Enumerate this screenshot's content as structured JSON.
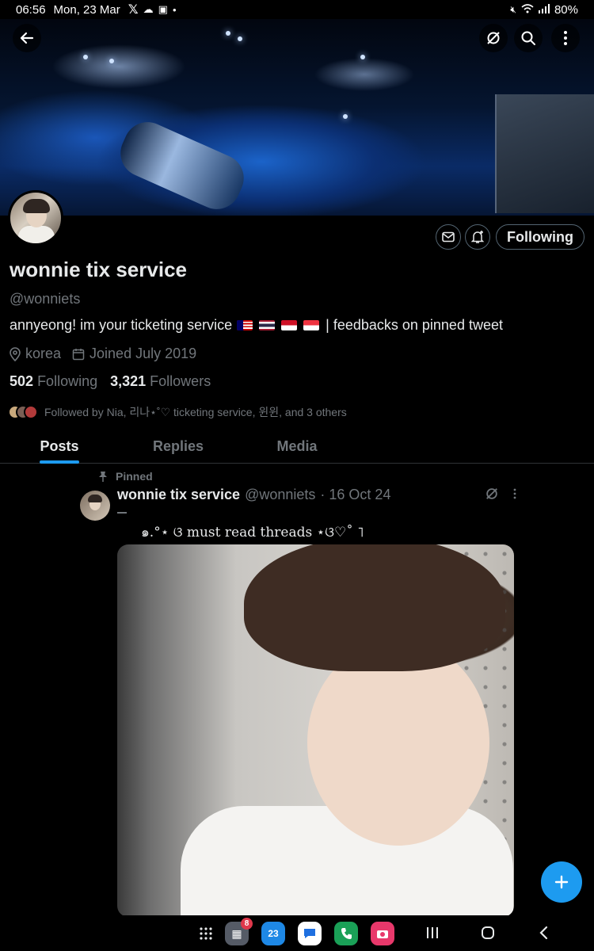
{
  "status_bar": {
    "time": "06:56",
    "date": "Mon, 23 Mar",
    "battery": "80%"
  },
  "profile": {
    "name": "wonnie tix service",
    "handle": "@wonniets",
    "bio_text": "annyeong! im your ticketing service",
    "bio_suffix": "| feedbacks on pinned tweet",
    "location": "korea",
    "joined": "Joined July 2019",
    "following_count": "502",
    "following_label": "Following",
    "followers_count": "3,321",
    "followers_label": "Followers",
    "followed_by": "Followed by Nia, 리나⋆˚♡ ticketing service, 윈윈, and 3 others",
    "follow_button": "Following"
  },
  "tabs": [
    {
      "label": "Posts",
      "active": true
    },
    {
      "label": "Replies",
      "active": false
    },
    {
      "label": "Media",
      "active": false
    }
  ],
  "post": {
    "pinned_label": "Pinned",
    "author": "wonnie tix service",
    "handle": "@wonniets",
    "date": "· 16 Oct 24",
    "text": "๑.°⋆ ଓ must read threads ⋆ଓ♡˚ ˥"
  },
  "app_badge": "8",
  "calendar_day": "23",
  "colors": {
    "accent": "#1d9bf0",
    "text": "#e7e9ea",
    "muted": "#71767b"
  },
  "icons": [
    "back-arrow-icon",
    "grok-icon",
    "search-icon",
    "more-vertical-icon",
    "mail-icon",
    "bell-plus-icon",
    "location-icon",
    "calendar-icon",
    "pin-icon",
    "plus-icon"
  ]
}
